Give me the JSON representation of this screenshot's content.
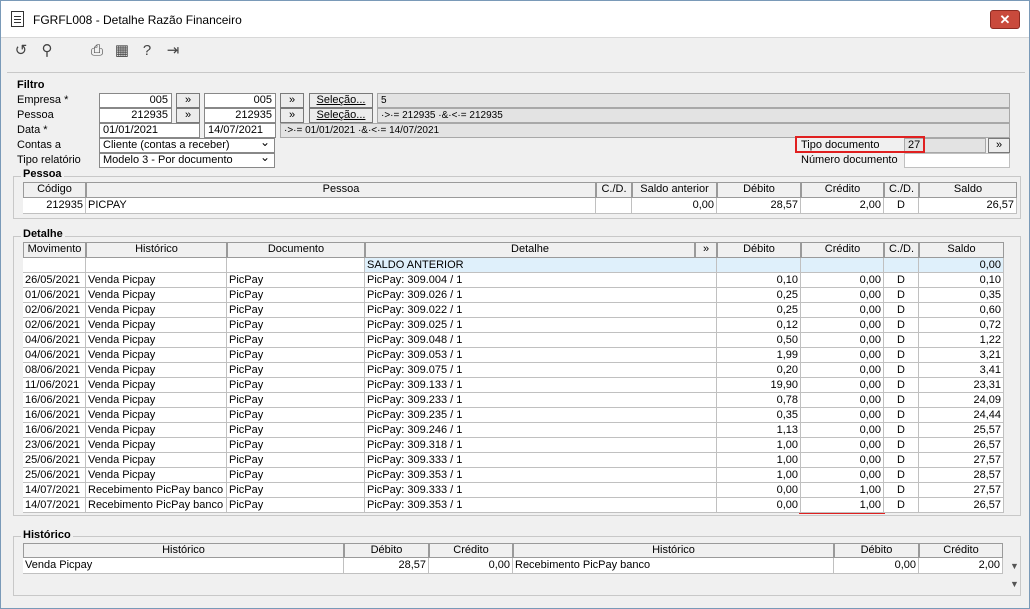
{
  "window": {
    "title": "FGRFL008 - Detalhe Razão Financeiro",
    "close": "✕"
  },
  "filtro": {
    "section": "Filtro",
    "empresa_label": "Empresa *",
    "empresa_from": "005",
    "empresa_to": "005",
    "empresa_sel_btn": "Seleção...",
    "empresa_sel_value": "5",
    "pessoa_label": "Pessoa",
    "pessoa_from": "212935",
    "pessoa_to": "212935",
    "pessoa_sel_btn": "Seleção...",
    "pessoa_sel_value": "·>·= 212935 ·&·<·= 212935",
    "data_label": "Data *",
    "data_from": "01/01/2021",
    "data_to": "14/07/2021",
    "data_sel_value": "·>·= 01/01/2021 ·&·<·= 14/07/2021",
    "contas_label": "Contas a",
    "contas_value": "Cliente (contas a receber)",
    "tipo_rel_label": "Tipo relatório",
    "tipo_rel_value": "Modelo 3 - Por documento",
    "tipo_doc_label": "Tipo documento",
    "tipo_doc_value": "27",
    "num_doc_label": "Número documento",
    "arrow": "»"
  },
  "pessoa": {
    "section": "Pessoa",
    "headers": [
      "Código",
      "Pessoa",
      "C./D.",
      "Saldo anterior",
      "Débito",
      "Crédito",
      "C./D.",
      "Saldo"
    ],
    "row": [
      "212935",
      "PICPAY",
      "",
      "0,00",
      "28,57",
      "2,00",
      "D",
      "26,57"
    ]
  },
  "detalhe": {
    "section": "Detalhe",
    "headers": [
      "Movimento",
      "Histórico",
      "Documento",
      "Detalhe",
      "»",
      "Débito",
      "Crédito",
      "C./D.",
      "Saldo"
    ],
    "first_row": {
      "detalhe": "SALDO ANTERIOR",
      "saldo": "0,00"
    },
    "rows": [
      [
        "26/05/2021",
        "Venda Picpay",
        "PicPay",
        "PicPay: 309.004 / 1",
        "0,10",
        "0,00",
        "D",
        "0,10"
      ],
      [
        "01/06/2021",
        "Venda Picpay",
        "PicPay",
        "PicPay: 309.026 / 1",
        "0,25",
        "0,00",
        "D",
        "0,35"
      ],
      [
        "02/06/2021",
        "Venda Picpay",
        "PicPay",
        "PicPay: 309.022 / 1",
        "0,25",
        "0,00",
        "D",
        "0,60"
      ],
      [
        "02/06/2021",
        "Venda Picpay",
        "PicPay",
        "PicPay: 309.025 / 1",
        "0,12",
        "0,00",
        "D",
        "0,72"
      ],
      [
        "04/06/2021",
        "Venda Picpay",
        "PicPay",
        "PicPay: 309.048 / 1",
        "0,50",
        "0,00",
        "D",
        "1,22"
      ],
      [
        "04/06/2021",
        "Venda Picpay",
        "PicPay",
        "PicPay: 309.053 / 1",
        "1,99",
        "0,00",
        "D",
        "3,21"
      ],
      [
        "08/06/2021",
        "Venda Picpay",
        "PicPay",
        "PicPay: 309.075 / 1",
        "0,20",
        "0,00",
        "D",
        "3,41"
      ],
      [
        "11/06/2021",
        "Venda Picpay",
        "PicPay",
        "PicPay: 309.133 / 1",
        "19,90",
        "0,00",
        "D",
        "23,31"
      ],
      [
        "16/06/2021",
        "Venda Picpay",
        "PicPay",
        "PicPay: 309.233 / 1",
        "0,78",
        "0,00",
        "D",
        "24,09"
      ],
      [
        "16/06/2021",
        "Venda Picpay",
        "PicPay",
        "PicPay: 309.235 / 1",
        "0,35",
        "0,00",
        "D",
        "24,44"
      ],
      [
        "16/06/2021",
        "Venda Picpay",
        "PicPay",
        "PicPay: 309.246 / 1",
        "1,13",
        "0,00",
        "D",
        "25,57"
      ],
      [
        "23/06/2021",
        "Venda Picpay",
        "PicPay",
        "PicPay: 309.318 / 1",
        "1,00",
        "0,00",
        "D",
        "26,57"
      ],
      [
        "25/06/2021",
        "Venda Picpay",
        "PicPay",
        "PicPay: 309.333 / 1",
        "1,00",
        "0,00",
        "D",
        "27,57"
      ],
      [
        "25/06/2021",
        "Venda Picpay",
        "PicPay",
        "PicPay: 309.353 / 1",
        "1,00",
        "0,00",
        "D",
        "28,57"
      ],
      [
        "14/07/2021",
        "Recebimento PicPay banco",
        "PicPay",
        "PicPay: 309.333 / 1",
        "0,00",
        "1,00",
        "D",
        "27,57"
      ],
      [
        "14/07/2021",
        "Recebimento PicPay banco",
        "PicPay",
        "PicPay: 309.353 / 1",
        "0,00",
        "1,00",
        "D",
        "26,57"
      ]
    ]
  },
  "historico": {
    "section": "Histórico",
    "headers": [
      "Histórico",
      "Débito",
      "Crédito",
      "Histórico",
      "Débito",
      "Crédito"
    ],
    "row": [
      "Venda Picpay",
      "28,57",
      "0,00",
      "Recebimento PicPay banco",
      "0,00",
      "2,00"
    ]
  },
  "icons": {
    "refresh": "refresh-icon",
    "search": "search-icon",
    "print": "print-icon",
    "calendar": "calendar-icon",
    "help": "help-icon",
    "exit": "exit-icon"
  },
  "colors": {
    "highlight": "#e02020",
    "selected_row": "#dff0fb"
  }
}
